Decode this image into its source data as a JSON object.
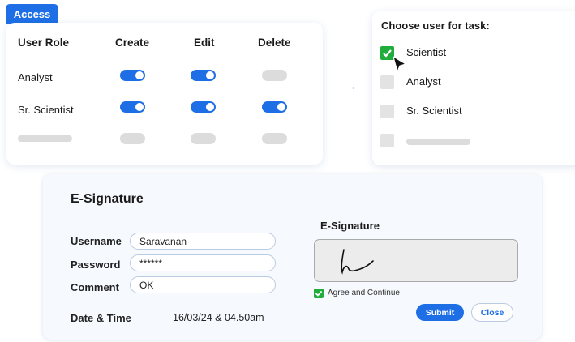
{
  "access": {
    "tab_label": "Access",
    "headers": [
      "User Role",
      "Create",
      "Edit",
      "Delete"
    ],
    "rows": [
      {
        "role": "Analyst",
        "create": true,
        "edit": true,
        "delete": false
      },
      {
        "role": "Sr. Scientist",
        "create": true,
        "edit": true,
        "delete": true
      }
    ]
  },
  "choose_user": {
    "title": "Choose user for task:",
    "options": [
      {
        "label": "Scientist",
        "checked": true
      },
      {
        "label": "Analyst",
        "checked": false
      },
      {
        "label": "Sr. Scientist",
        "checked": false
      }
    ]
  },
  "esignature": {
    "title": "E-Signature",
    "username_label": "Username",
    "username_value": "Saravanan",
    "password_label": "Password",
    "password_value": "******",
    "comment_label": "Comment",
    "comment_value": "OK",
    "datetime_label": "Date & Time",
    "datetime_value": "16/03/24 & 04.50am",
    "signature_label": "E-Signature",
    "agree_label": "Agree and Continue",
    "agree_checked": true,
    "submit_label": "Submit",
    "close_label": "Close"
  },
  "colors": {
    "accent": "#1e6fe6",
    "check_green": "#1fae3b",
    "toggle_off": "#dcdcdc"
  },
  "icons": [
    "check-icon",
    "mouse-cursor-icon",
    "signature-stroke"
  ]
}
